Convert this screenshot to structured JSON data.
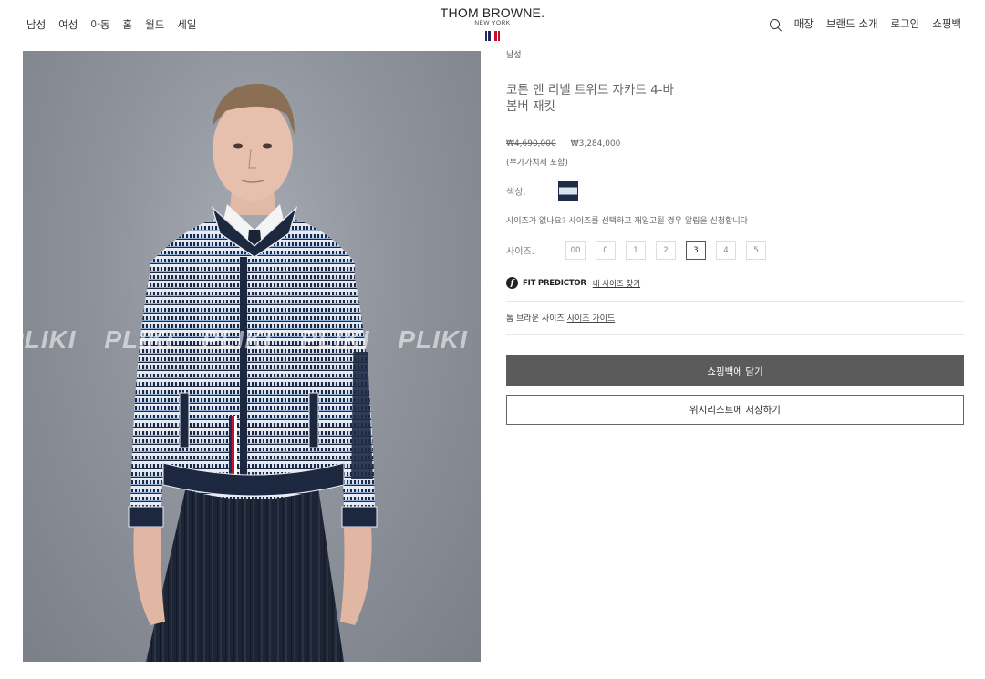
{
  "header": {
    "nav_left": [
      "남성",
      "여성",
      "아동",
      "홈",
      "월드",
      "세일"
    ],
    "logo_main": "THOM BROWNE.",
    "logo_sub": "NEW YORK",
    "flag_colors": [
      "#1f2d5c",
      "#ffffff",
      "#c8102e"
    ],
    "nav_right": {
      "search_icon": "search-icon",
      "stores": "매장",
      "brand": "브랜드 소개",
      "login": "로그인",
      "bag": "쇼핑백"
    }
  },
  "product_image": {
    "watermark": "PLIKI   PLIKI   PLIKI   PLIKI   PLIKI"
  },
  "product": {
    "breadcrumb": "남성",
    "title": "코튼 앤 리넬 트위드 자카드 4-바 봄버 재킷",
    "price_original": "₩4,690,000",
    "price_sale": "₩3,284,000",
    "price_note": "(부가가치세 포함)",
    "color_label": "색상.",
    "swatch_colors": [
      "#1f2d44",
      "#d9e3ef"
    ],
    "size_notice": "사이즈가 없나요? 사이즈를 선택하고 재입고될 경우 알림을 신청합니다",
    "size_label": "사이즈.",
    "sizes": [
      "00",
      "0",
      "1",
      "2",
      "3",
      "4",
      "5"
    ],
    "selected_size": "3",
    "fit_icon": "fit-predictor-icon",
    "fit_label": "FIT PREDICTOR",
    "fit_link": "내 사이즈 찾기",
    "sizeguide_prefix": "톰 브라운 사이즈",
    "sizeguide_link": "사이즈 가이드",
    "add_to_bag": "쇼핑백에 담기",
    "save_wishlist": "위시리스트에 저장하기"
  }
}
